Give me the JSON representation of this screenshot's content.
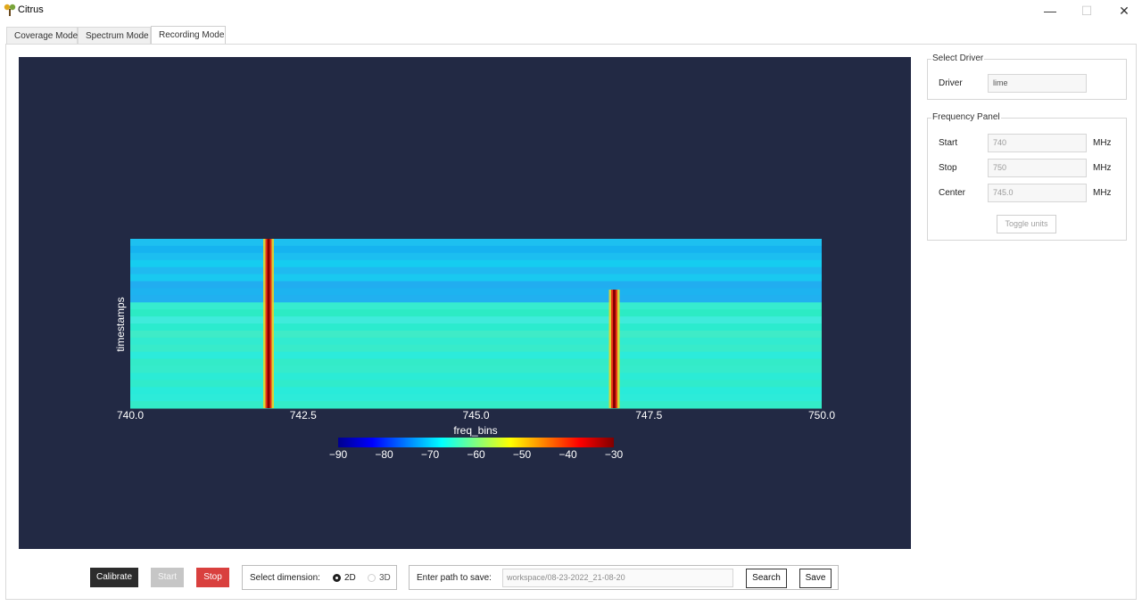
{
  "window": {
    "title": "Citrus",
    "controls": {
      "minimize": "—",
      "maximize": "☐",
      "close": "✕"
    }
  },
  "tabs": [
    {
      "label": "Coverage Mode",
      "active": false
    },
    {
      "label": "Spectrum Mode",
      "active": false
    },
    {
      "label": "Recording Mode",
      "active": true
    }
  ],
  "chart_data": {
    "type": "heatmap",
    "xlabel": "freq_bins",
    "ylabel": "timestamps",
    "xlim": [
      740.0,
      750.0
    ],
    "x_ticks": [
      "740.0",
      "742.5",
      "745.0",
      "747.5",
      "750.0"
    ],
    "colorbar": {
      "range": [
        -90,
        -30
      ],
      "ticks": [
        "−90",
        "−80",
        "−70",
        "−60",
        "−50",
        "−40",
        "−30"
      ]
    },
    "background_color": "#222944",
    "signals": [
      {
        "freq_mhz": 742.0,
        "level_db": -30
      },
      {
        "freq_mhz": 747.0,
        "level_db": -30
      }
    ]
  },
  "select_driver": {
    "title": "Select Driver",
    "driver_label": "Driver",
    "driver_value": "lime"
  },
  "frequency_panel": {
    "title": "Frequency Panel",
    "start_label": "Start",
    "start_value": "740",
    "start_unit": "MHz",
    "stop_label": "Stop",
    "stop_value": "750",
    "stop_unit": "MHz",
    "center_label": "Center",
    "center_value": "745.0",
    "center_unit": "MHz",
    "toggle_label": "Toggle units"
  },
  "controls": {
    "calibrate": "Calibrate",
    "start": "Start",
    "stop": "Stop",
    "dimension_label": "Select dimension:",
    "dim_2d": "2D",
    "dim_3d": "3D",
    "path_label": "Enter path to save:",
    "path_value": "workspace/08-23-2022_21-08-20",
    "search": "Search",
    "save": "Save"
  },
  "colors": {
    "stop_button": "#d9403e",
    "calibrate_button": "#2c2c2c"
  }
}
